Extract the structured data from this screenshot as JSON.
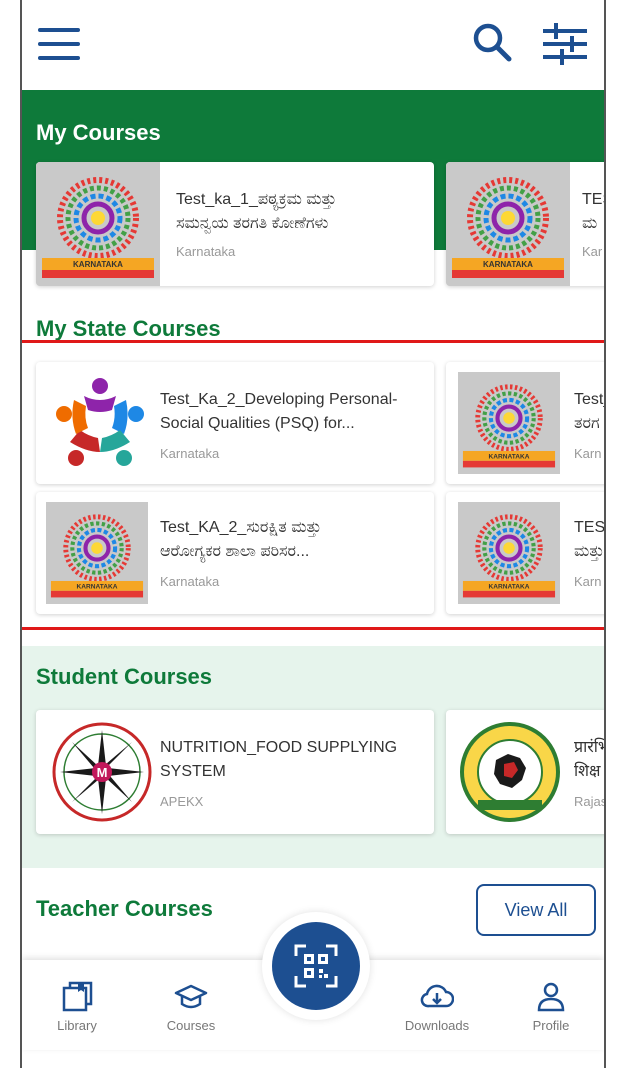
{
  "header": {
    "menu_icon": "hamburger-menu-icon",
    "search_icon": "search-icon",
    "filter_icon": "filter-sliders-icon"
  },
  "my_courses": {
    "title": "My Courses",
    "cards": [
      {
        "title_line1": "Test_ka_1_ಪಠ್ಯಕ್ರಮ ಮತ್ತು",
        "title_line2": "ಸಮನ್ವಯ ತರಗತಿ ಕೋಣೆಗಳು",
        "source": "Karnataka",
        "thumb_caption": "KARNATAKA"
      },
      {
        "title_line1": "TES",
        "title_line2": "ಮ",
        "source": "Kar",
        "thumb_caption": "KARNATAKA"
      }
    ]
  },
  "my_state_courses": {
    "title": "My State Courses",
    "cards": [
      {
        "title_line1": "Test_Ka_2_Developing Personal-",
        "title_line2": "Social Qualities (PSQ) for...",
        "source": "Karnataka"
      },
      {
        "title_line1": "Test_",
        "title_line2": "ತರಗ",
        "source": "Karn",
        "thumb_caption": "KARNATAKA"
      },
      {
        "title_line1": "Test_KA_2_ಸುರಕ್ಷಿತ ಮತ್ತು",
        "title_line2": "ಆರೋಗ್ಯಕರ ಶಾಲಾ ಪರಿಸರ...",
        "source": "Karnataka",
        "thumb_caption": "KARNATAKA"
      },
      {
        "title_line1": "TEST",
        "title_line2": "ಮತ್ತು",
        "source": "Karn",
        "thumb_caption": "KARNATAKA"
      }
    ]
  },
  "student_courses": {
    "title": "Student Courses",
    "cards": [
      {
        "title_line1": "NUTRITION_FOOD SUPPLYING",
        "title_line2": "SYSTEM",
        "source": "APEKX",
        "badge": "M"
      },
      {
        "title_line1": "प्रारंभि",
        "title_line2": "शिक्ष",
        "source": "Rajas"
      }
    ]
  },
  "teacher_courses": {
    "title": "Teacher Courses",
    "view_all": "View All"
  },
  "bottom_nav": {
    "items": [
      {
        "label": "Library",
        "icon": "library-book-icon"
      },
      {
        "label": "Courses",
        "icon": "graduation-cap-icon"
      },
      {
        "label": "Downloads",
        "icon": "cloud-download-icon"
      },
      {
        "label": "Profile",
        "icon": "user-profile-icon"
      }
    ],
    "scan_icon": "qr-scan-icon"
  },
  "colors": {
    "primary_blue": "#1d4f91",
    "green_header": "#0e7a3a",
    "green_title": "#0e7a3a",
    "light_green_bg": "#e6f4ec",
    "highlight_red": "#e01818"
  }
}
